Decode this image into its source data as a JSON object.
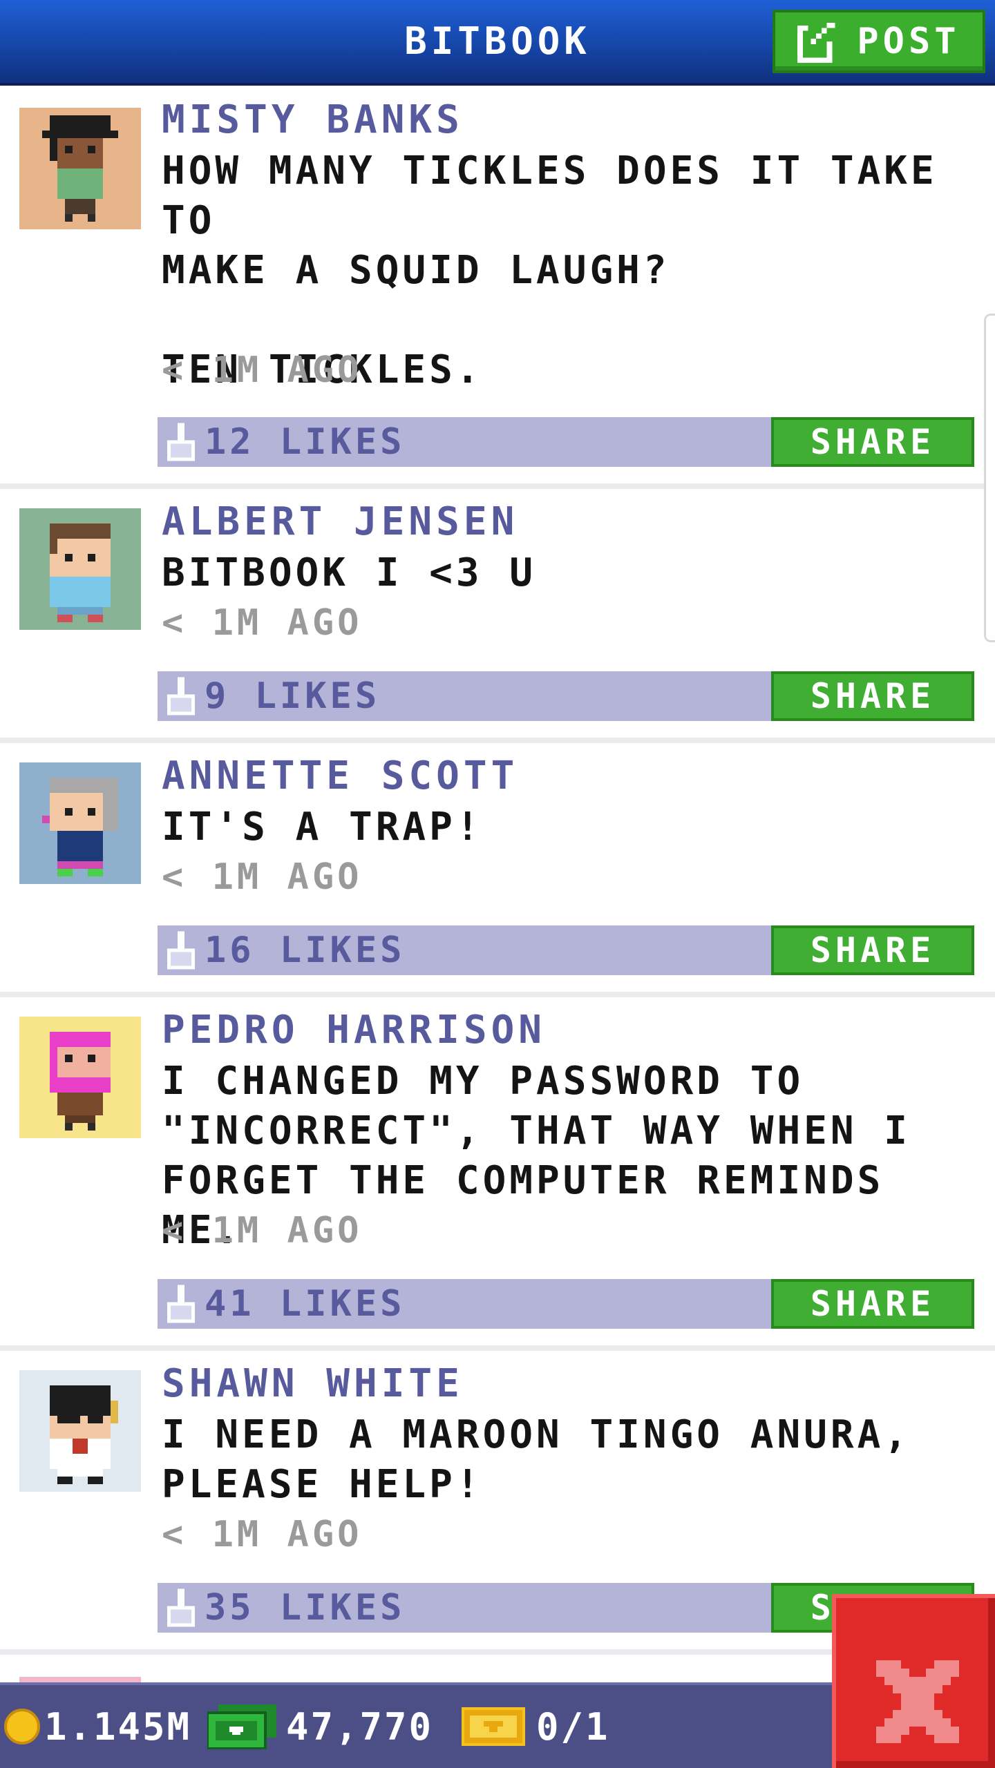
{
  "header": {
    "title": "BITBOOK",
    "post_label": "POST"
  },
  "posts": [
    {
      "name": "MISTY BANKS",
      "text": "HOW MANY TICKLES DOES IT TAKE TO\nMAKE A SQUID LAUGH?\n\nTEN TICKLES.",
      "time": "< 1M AGO",
      "likes": "12 LIKES",
      "share": "SHARE",
      "avatar_bg": "#e8b48a"
    },
    {
      "name": "ALBERT JENSEN",
      "text": "BITBOOK I <3 U",
      "time": "< 1M AGO",
      "likes": "9 LIKES",
      "share": "SHARE",
      "avatar_bg": "#88b394"
    },
    {
      "name": "ANNETTE SCOTT",
      "text": "IT'S A TRAP!",
      "time": "< 1M AGO",
      "likes": "16 LIKES",
      "share": "SHARE",
      "avatar_bg": "#8fb0cc"
    },
    {
      "name": "PEDRO HARRISON",
      "text": "I CHANGED MY PASSWORD TO\n\"INCORRECT\", THAT WAY WHEN I\nFORGET THE COMPUTER REMINDS ME.",
      "time": "< 1M AGO",
      "likes": "41 LIKES",
      "share": "SHARE",
      "avatar_bg": "#f8e48a"
    },
    {
      "name": "SHAWN WHITE",
      "text": "I NEED A MAROON TINGO ANURA,\nPLEASE HELP!",
      "time": "< 1M AGO",
      "likes": "35 LIKES",
      "share": "SHARE",
      "avatar_bg": "#dfe9ef"
    }
  ],
  "footer": {
    "coins": "1.145M",
    "bux": "47,770",
    "tickets": "0/1"
  },
  "colors": {
    "header_blue": "#1646a8",
    "post_green": "#3cae2e",
    "name_purple": "#575a9c",
    "like_bar": "#b3b4d8",
    "footer": "#4c4f86",
    "close_red": "#e02a2a"
  },
  "icons": [
    "post-edit-icon",
    "like-hand-icon",
    "coin-icon",
    "cash-icon",
    "ticket-icon",
    "close-x-icon"
  ]
}
